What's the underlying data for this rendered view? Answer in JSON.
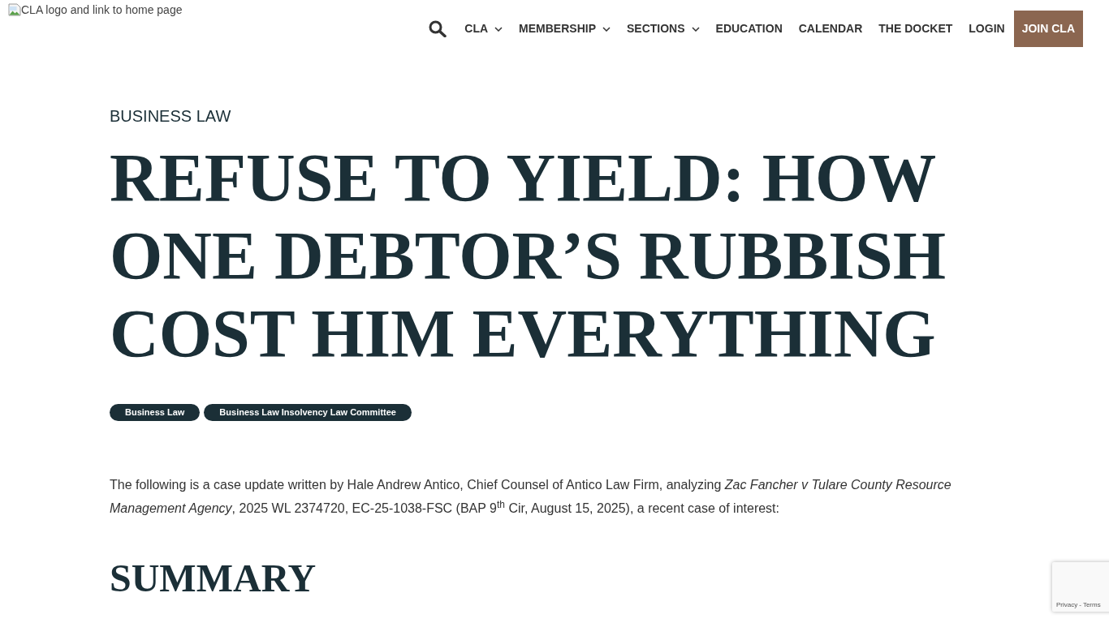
{
  "header": {
    "logo_alt": "CLA logo and link to home page",
    "nav": [
      {
        "label": "CLA",
        "dropdown": true
      },
      {
        "label": "MEMBERSHIP",
        "dropdown": true
      },
      {
        "label": "SECTIONS",
        "dropdown": true
      },
      {
        "label": "EDUCATION",
        "dropdown": false
      },
      {
        "label": "CALENDAR",
        "dropdown": false
      },
      {
        "label": "THE DOCKET",
        "dropdown": false
      },
      {
        "label": "LOGIN",
        "dropdown": false
      }
    ],
    "cta": "JOIN CLA"
  },
  "article": {
    "category": "BUSINESS LAW",
    "title": "REFUSE TO YIELD: HOW ONE DEBTOR’S RUBBISH COST HIM EVERYTHING",
    "tags": [
      "Business Law",
      "Business Law Insolvency Law Committee"
    ],
    "intro": "The following is a case update written by Hale Andrew Antico, Chief Counsel of Antico Law Firm, analyzing *Zac Fancher v Tulare County Resource Management Agency*, 2025 WL 2374720, EC-25-1038-FSC (BAP 9$^{th}$ Cir, August 15, 2025), a recent case of interest:",
    "section_heading": "SUMMARY"
  },
  "recaptcha": {
    "links": [
      "Privacy",
      "Terms"
    ],
    "separator": "-"
  }
}
